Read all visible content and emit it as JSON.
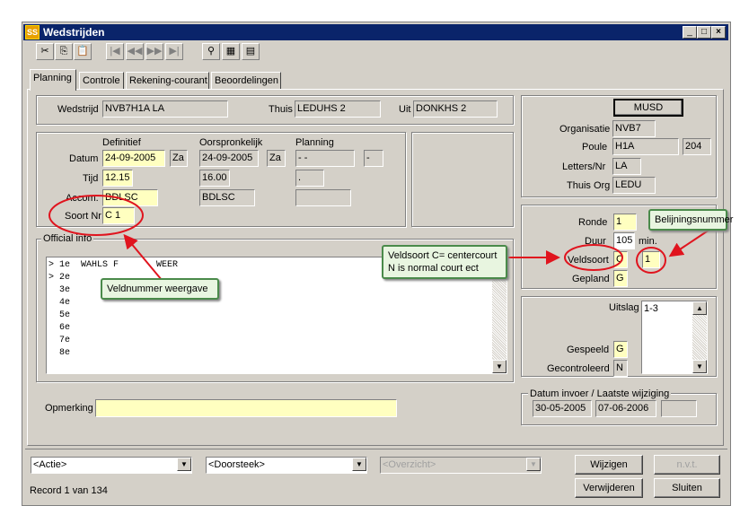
{
  "window": {
    "title": "Wedstrijden",
    "app_icon": "SS"
  },
  "tabs": [
    "Planning",
    "Controle",
    "Rekening-courant",
    "Beoordelingen"
  ],
  "match": {
    "wedstrijd_label": "Wedstrijd",
    "wedstrijd_value": "NVB7H1A  LA",
    "thuis_label": "Thuis",
    "thuis_value": "LEDUHS 2",
    "uit_label": "Uit",
    "uit_value": "DONKHS 2"
  },
  "schedule": {
    "col_definitief": "Definitief",
    "col_oorspronkelijk": "Oorspronkelijk",
    "col_planning": "Planning",
    "datum_label": "Datum",
    "datum_def": "24-09-2005",
    "dag_def": "Za",
    "datum_oorspr": "24-09-2005",
    "dag_oorspr": "Za",
    "datum_plan": " -  -",
    "dag_plan": "-",
    "tijd_label": "Tijd",
    "tijd_def": "12.15",
    "tijd_oorspr": "16.00",
    "tijd_plan": " .",
    "accom_label": "Accom.",
    "accom_def": "BDLSC",
    "accom_oorspr": "BDLSC",
    "soort_label": "Soort Nr",
    "soort_def": "C 1"
  },
  "official_info": {
    "title": "Official info",
    "lines": [
      "> 1e  WAHLS F       WEER",
      "> 2e",
      "  3e",
      "  4e",
      "  5e",
      "  6e",
      "  7e",
      "  8e"
    ]
  },
  "opmerking": {
    "label": "Opmerking",
    "value": ""
  },
  "organisation": {
    "button_label": "MUSD",
    "organisatie_label": "Organisatie",
    "organisatie_value": "NVB7",
    "poule_label": "Poule",
    "poule_value": "H1A",
    "poule_num": "204",
    "letters_label": "Letters/Nr",
    "letters_value": "LA",
    "thuisorg_label": "Thuis Org",
    "thuisorg_value": "LEDU"
  },
  "court": {
    "ronde_label": "Ronde",
    "ronde_value": "1",
    "duur_label": "Duur",
    "duur_value": "105",
    "duur_unit": "min.",
    "veldsoort_label": "Veldsoort",
    "veldsoort_value": "C",
    "belijning_value": "1",
    "gepland_label": "Gepland",
    "gepland_value": "G"
  },
  "result": {
    "uitslag_label": "Uitslag",
    "uitslag_value": "1-3",
    "gespeeld_label": "Gespeeld",
    "gespeeld_value": "G",
    "gecontroleerd_label": "Gecontroleerd",
    "gecontroleerd_value": "N"
  },
  "dates": {
    "title": "Datum invoer / Laatste wijziging",
    "invoer": "30-05-2005",
    "wijziging": "07-06-2006"
  },
  "bottom": {
    "actie": "<Actie>",
    "doorsteek": "<Doorsteek>",
    "overzicht": "<Overzicht>",
    "wijzigen": "Wijzigen",
    "nvt": "n.v.t.",
    "verwijderen": "Verwijderen",
    "sluiten": "Sluiten",
    "record": "Record 1 van 134"
  },
  "annotations": {
    "veldnummer": "Veldnummer weergave",
    "veldsoort_line1": "Veldsoort C= centercourt",
    "veldsoort_line2": "N is normal court ect",
    "belijning": "Belijningsnummer"
  },
  "colors": {
    "titlebar": "#0a246a",
    "editable_field": "#ffffc0",
    "annotation_red": "#e0141e",
    "callout_border": "#4a8a4a"
  }
}
